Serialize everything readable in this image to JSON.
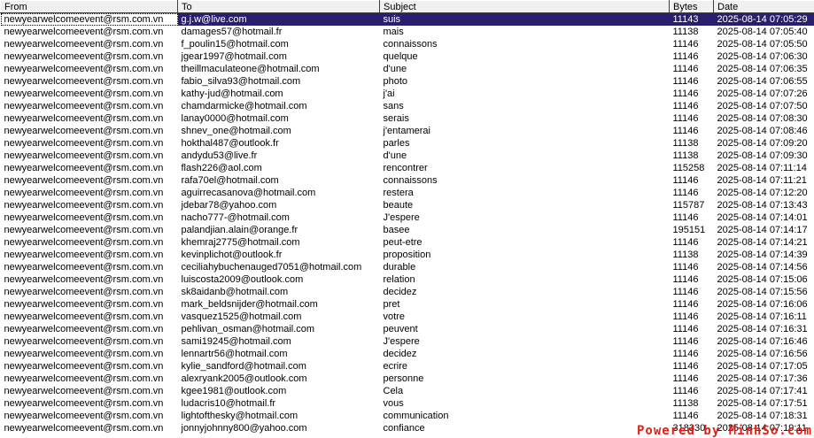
{
  "columns": {
    "from": "From",
    "to": "To",
    "subject": "Subject",
    "bytes": "Bytes",
    "date": "Date"
  },
  "rows": [
    {
      "from": "newyearwelcomeevent@rsm.com.vn",
      "to": "g.j.w@live.com",
      "subject": "suis",
      "bytes": "11143",
      "date": "2025-08-14 07:05:29",
      "selected": true
    },
    {
      "from": "newyearwelcomeevent@rsm.com.vn",
      "to": "damages57@hotmail.fr",
      "subject": "mais",
      "bytes": "11138",
      "date": "2025-08-14 07:05:40"
    },
    {
      "from": "newyearwelcomeevent@rsm.com.vn",
      "to": "f_poulin15@hotmail.com",
      "subject": "connaissons",
      "bytes": "11146",
      "date": "2025-08-14 07:05:50"
    },
    {
      "from": "newyearwelcomeevent@rsm.com.vn",
      "to": "jgear1997@hotmail.com",
      "subject": "quelque",
      "bytes": "11146",
      "date": "2025-08-14 07:06:30"
    },
    {
      "from": "newyearwelcomeevent@rsm.com.vn",
      "to": "theillmaculateone@hotmail.com",
      "subject": "d'une",
      "bytes": "11146",
      "date": "2025-08-14 07:06:35"
    },
    {
      "from": "newyearwelcomeevent@rsm.com.vn",
      "to": "fabio_silva93@hotmail.com",
      "subject": "photo",
      "bytes": "11146",
      "date": "2025-08-14 07:06:55"
    },
    {
      "from": "newyearwelcomeevent@rsm.com.vn",
      "to": "kathy-jud@hotmail.com",
      "subject": "j'ai",
      "bytes": "11146",
      "date": "2025-08-14 07:07:26"
    },
    {
      "from": "newyearwelcomeevent@rsm.com.vn",
      "to": "chamdarmicke@hotmail.com",
      "subject": "sans",
      "bytes": "11146",
      "date": "2025-08-14 07:07:50"
    },
    {
      "from": "newyearwelcomeevent@rsm.com.vn",
      "to": "lanay0000@hotmail.com",
      "subject": "serais",
      "bytes": "11146",
      "date": "2025-08-14 07:08:30"
    },
    {
      "from": "newyearwelcomeevent@rsm.com.vn",
      "to": "shnev_one@hotmail.com",
      "subject": "j'entamerai",
      "bytes": "11146",
      "date": "2025-08-14 07:08:46"
    },
    {
      "from": "newyearwelcomeevent@rsm.com.vn",
      "to": "hokthal487@outlook.fr",
      "subject": "parles",
      "bytes": "11138",
      "date": "2025-08-14 07:09:20"
    },
    {
      "from": "newyearwelcomeevent@rsm.com.vn",
      "to": "andydu53@live.fr",
      "subject": "d'une",
      "bytes": "11138",
      "date": "2025-08-14 07:09:30"
    },
    {
      "from": "newyearwelcomeevent@rsm.com.vn",
      "to": "flash226@aol.com",
      "subject": "rencontrer",
      "bytes": "115258",
      "date": "2025-08-14 07:11:14"
    },
    {
      "from": "newyearwelcomeevent@rsm.com.vn",
      "to": "rafa70el@hotmail.com",
      "subject": "connaissons",
      "bytes": "11146",
      "date": "2025-08-14 07:11:21"
    },
    {
      "from": "newyearwelcomeevent@rsm.com.vn",
      "to": "aguirrecasanova@hotmail.com",
      "subject": "restera",
      "bytes": "11146",
      "date": "2025-08-14 07:12:20"
    },
    {
      "from": "newyearwelcomeevent@rsm.com.vn",
      "to": "jdebar78@yahoo.com",
      "subject": "beaute",
      "bytes": "115787",
      "date": "2025-08-14 07:13:43"
    },
    {
      "from": "newyearwelcomeevent@rsm.com.vn",
      "to": "nacho777-@hotmail.com",
      "subject": "J'espere",
      "bytes": "11146",
      "date": "2025-08-14 07:14:01"
    },
    {
      "from": "newyearwelcomeevent@rsm.com.vn",
      "to": "palandjian.alain@orange.fr",
      "subject": "basee",
      "bytes": "195151",
      "date": "2025-08-14 07:14:17"
    },
    {
      "from": "newyearwelcomeevent@rsm.com.vn",
      "to": "khemraj2775@hotmail.com",
      "subject": "peut-etre",
      "bytes": "11146",
      "date": "2025-08-14 07:14:21"
    },
    {
      "from": "newyearwelcomeevent@rsm.com.vn",
      "to": "kevinplichot@outlook.fr",
      "subject": "proposition",
      "bytes": "11138",
      "date": "2025-08-14 07:14:39"
    },
    {
      "from": "newyearwelcomeevent@rsm.com.vn",
      "to": "ceciliahybuchenauged7051@hotmail.com",
      "subject": "durable",
      "bytes": "11146",
      "date": "2025-08-14 07:14:56"
    },
    {
      "from": "newyearwelcomeevent@rsm.com.vn",
      "to": "luiscosta2009@outlook.com",
      "subject": "relation",
      "bytes": "11146",
      "date": "2025-08-14 07:15:06"
    },
    {
      "from": "newyearwelcomeevent@rsm.com.vn",
      "to": "sk8aidanb@hotmail.com",
      "subject": "decidez",
      "bytes": "11146",
      "date": "2025-08-14 07:15:56"
    },
    {
      "from": "newyearwelcomeevent@rsm.com.vn",
      "to": "mark_beldsnijder@hotmail.com",
      "subject": "pret",
      "bytes": "11146",
      "date": "2025-08-14 07:16:06"
    },
    {
      "from": "newyearwelcomeevent@rsm.com.vn",
      "to": "vasquez1525@hotmail.com",
      "subject": "votre",
      "bytes": "11146",
      "date": "2025-08-14 07:16:11"
    },
    {
      "from": "newyearwelcomeevent@rsm.com.vn",
      "to": "pehlivan_osman@hotmail.com",
      "subject": "peuvent",
      "bytes": "11146",
      "date": "2025-08-14 07:16:31"
    },
    {
      "from": "newyearwelcomeevent@rsm.com.vn",
      "to": "sami19245@hotmail.com",
      "subject": "J'espere",
      "bytes": "11146",
      "date": "2025-08-14 07:16:46"
    },
    {
      "from": "newyearwelcomeevent@rsm.com.vn",
      "to": "lennartr56@hotmail.com",
      "subject": "decidez",
      "bytes": "11146",
      "date": "2025-08-14 07:16:56"
    },
    {
      "from": "newyearwelcomeevent@rsm.com.vn",
      "to": "kylie_sandford@hotmail.com",
      "subject": "ecrire",
      "bytes": "11146",
      "date": "2025-08-14 07:17:05"
    },
    {
      "from": "newyearwelcomeevent@rsm.com.vn",
      "to": "alexryank2005@outlook.com",
      "subject": "personne",
      "bytes": "11146",
      "date": "2025-08-14 07:17:36"
    },
    {
      "from": "newyearwelcomeevent@rsm.com.vn",
      "to": "kgee1981@outlook.com",
      "subject": "Cela",
      "bytes": "11146",
      "date": "2025-08-14 07:17:41"
    },
    {
      "from": "newyearwelcomeevent@rsm.com.vn",
      "to": "ludacris10@hotmail.fr",
      "subject": "vous",
      "bytes": "11138",
      "date": "2025-08-14 07:17:51"
    },
    {
      "from": "newyearwelcomeevent@rsm.com.vn",
      "to": "lightofthesky@hotmail.com",
      "subject": "communication",
      "bytes": "11146",
      "date": "2025-08-14 07:18:31"
    },
    {
      "from": "newyearwelcomeevent@rsm.com.vn",
      "to": "jonnyjohnny800@yahoo.com",
      "subject": "confiance",
      "bytes": "318330",
      "date": "2025-08-14 07:19:11"
    }
  ],
  "watermark": "Powered by MinhSo.com",
  "colors": {
    "selection_bg": "#2a1f6e",
    "header_bg": "#f0f0f0",
    "watermark": "#e0201a"
  }
}
